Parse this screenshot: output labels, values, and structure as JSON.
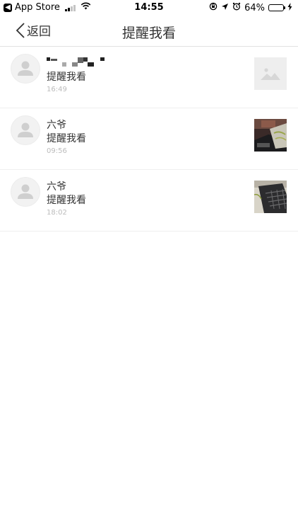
{
  "status_bar": {
    "back_app": "App Store",
    "time": "14:55",
    "battery": "64%",
    "battery_level": 0.64,
    "battery_color": "#f5c518"
  },
  "nav": {
    "back_label": "返回",
    "title": "提醒我看"
  },
  "list": {
    "rows": [
      {
        "name": "",
        "message": "提醒我看",
        "time": "16:49",
        "thumb": "image-placeholder"
      },
      {
        "name": "六爷",
        "message": "提醒我看",
        "time": "09:56",
        "thumb": "photo"
      },
      {
        "name": "六爷",
        "message": "提醒我看",
        "time": "18:02",
        "thumb": "photo"
      }
    ]
  }
}
